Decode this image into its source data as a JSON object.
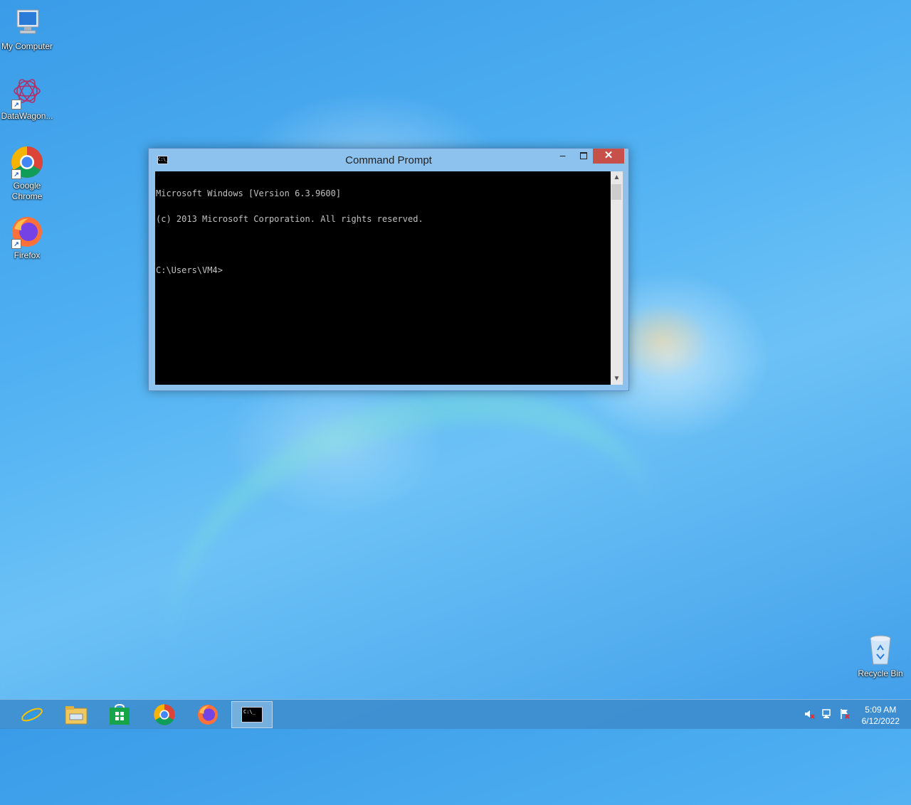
{
  "desktop": {
    "icons": [
      {
        "label": "My Computer",
        "icon": "computer-icon"
      },
      {
        "label": "DataWagon...",
        "icon": "datawagon-icon"
      },
      {
        "label": "Google Chrome",
        "icon": "chrome-icon"
      },
      {
        "label": "Firefox",
        "icon": "firefox-icon"
      },
      {
        "label": "Recycle Bin",
        "icon": "recycle-bin-icon"
      }
    ]
  },
  "window": {
    "title": "Command Prompt",
    "icon_label": "C:\\_",
    "controls": {
      "minimize": "–",
      "close": "✕"
    },
    "console_lines": [
      "Microsoft Windows [Version 6.3.9600]",
      "(c) 2013 Microsoft Corporation. All rights reserved.",
      "",
      "C:\\Users\\VM4>"
    ]
  },
  "taskbar": {
    "pinned": [
      {
        "icon": "internet-explorer-icon"
      },
      {
        "icon": "file-explorer-icon"
      },
      {
        "icon": "store-icon"
      },
      {
        "icon": "chrome-icon"
      },
      {
        "icon": "firefox-icon"
      },
      {
        "icon": "command-prompt-icon",
        "active": true,
        "label": "C:\\_"
      }
    ],
    "tray": [
      "volume-muted-icon",
      "network-icon",
      "action-center-flag-icon"
    ],
    "clock": {
      "time": "5:09 AM",
      "date": "6/12/2022"
    }
  },
  "colors": {
    "close_button": "#c7504a",
    "window_frame": "#8ec2ee",
    "console_bg": "#000000",
    "console_text": "#c0c0c0"
  }
}
